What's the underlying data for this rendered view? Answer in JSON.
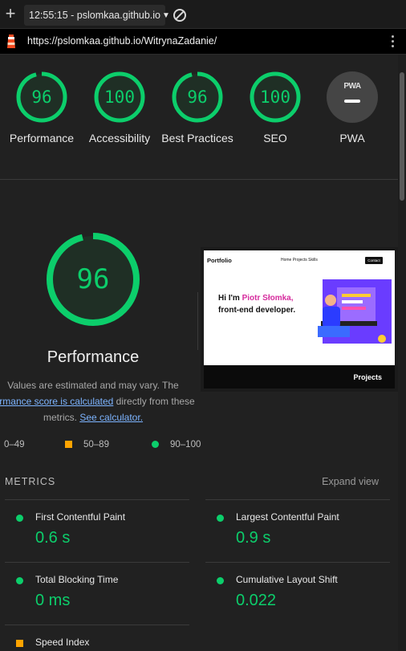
{
  "browser": {
    "tab_title": "12:55:15 - pslomkaa.github.io",
    "tab_arrow": "▼",
    "url": "https://pslomkaa.github.io/WitrynaZadanie/"
  },
  "categories": [
    {
      "score": "96",
      "label": "Performance"
    },
    {
      "score": "100",
      "label": "Accessibility"
    },
    {
      "score": "96",
      "label": "Best Practices"
    },
    {
      "score": "100",
      "label": "SEO"
    },
    {
      "label": "PWA",
      "badge": "PWA"
    }
  ],
  "category_fraction": [
    0.96,
    1.0,
    0.96,
    1.0
  ],
  "performance": {
    "score": "96",
    "fraction": 0.96,
    "title": "Performance",
    "desc_part1": "Values are estimated and may vary. The",
    "desc_link1": "formance score is calculated",
    "desc_part2": " directly from these",
    "desc_part3": "metrics. ",
    "desc_link2": "See calculator."
  },
  "screenshot": {
    "brand": "Portfolio",
    "links": "Home  Projects  Skills",
    "contact": "Contact",
    "hero_line1": "Hi I'm ",
    "hero_name": "Piotr Słomka,",
    "hero_line2": "front-end developer.",
    "footer": "Projects"
  },
  "legend": {
    "fail": "0–49",
    "average": "50–89",
    "pass": "90–100"
  },
  "metrics": {
    "title": "METRICS",
    "expand": "Expand view",
    "items": [
      {
        "label": "First Contentful Paint",
        "value": "0.6 s"
      },
      {
        "label": "Largest Contentful Paint",
        "value": "0.9 s"
      },
      {
        "label": "Total Blocking Time",
        "value": "0 ms"
      },
      {
        "label": "Cumulative Layout Shift",
        "value": "0.022"
      },
      {
        "label": "Speed Index",
        "value": ""
      }
    ]
  },
  "colors": {
    "pass": "#0cce6b",
    "average": "#ffa400",
    "link": "#7db4ff",
    "background": "#212121"
  }
}
